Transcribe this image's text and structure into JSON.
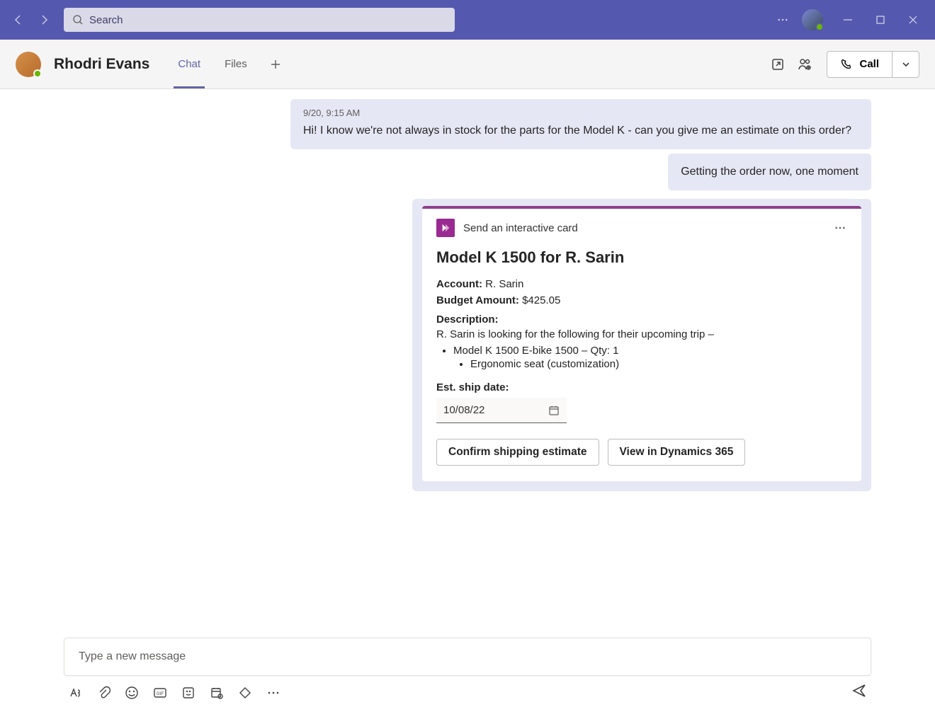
{
  "titlebar": {
    "search_placeholder": "Search"
  },
  "chat": {
    "name": "Rhodri Evans",
    "tabs": [
      "Chat",
      "Files"
    ],
    "active_tab": 0,
    "call_label": "Call"
  },
  "messages": {
    "incoming": {
      "time": "9/20, 9:15 AM",
      "text": "Hi! I know we're not always in stock for the parts for the Model K - can you give me an estimate on this order?"
    },
    "outgoing": {
      "text": "Getting the order now, one moment"
    }
  },
  "card": {
    "app_label": "Send an interactive card",
    "title": "Model K 1500 for R. Sarin",
    "account_label": "Account:",
    "account_value": "R. Sarin",
    "budget_label": "Budget Amount:",
    "budget_value": "$425.05",
    "description_label": "Description:",
    "description_text": "R. Sarin is looking for the following for their upcoming trip –",
    "list_item": "Model K 1500 E-bike 1500 – Qty: 1",
    "sublist_item": "Ergonomic seat (customization)",
    "ship_label": "Est. ship date:",
    "ship_value": "10/08/22",
    "action1": "Confirm shipping estimate",
    "action2": "View in Dynamics 365"
  },
  "composer": {
    "placeholder": "Type a new message"
  }
}
